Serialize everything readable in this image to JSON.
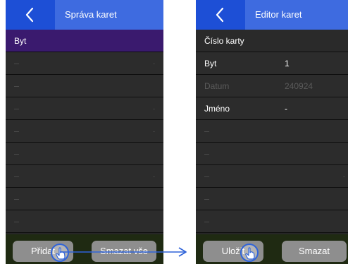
{
  "colors": {
    "header": "#3e6be0",
    "back_button": "#1d4fd6",
    "selected_row": "#3a1a6e",
    "button": "#8e8e8e",
    "arrow": "#2f63d9"
  },
  "left_screen": {
    "back_icon": "chevron-left-icon",
    "title": "Správa karet",
    "selected_item": "Byt",
    "add_label": "Přidat",
    "delete_all_label": "Smazat vše"
  },
  "right_screen": {
    "back_icon": "chevron-left-icon",
    "title": "Editor karet",
    "card_number_label": "Číslo karty",
    "fields": [
      {
        "label": "Byt",
        "value": "1"
      },
      {
        "label": "Datum",
        "value": "240924"
      },
      {
        "label": "Jméno",
        "value": "-"
      }
    ],
    "save_label": "Uložit",
    "delete_label": "Smazat"
  },
  "annotations": {
    "touch_icon": "hand-pointer-icon",
    "arrow_icon": "arrow-right-icon"
  }
}
